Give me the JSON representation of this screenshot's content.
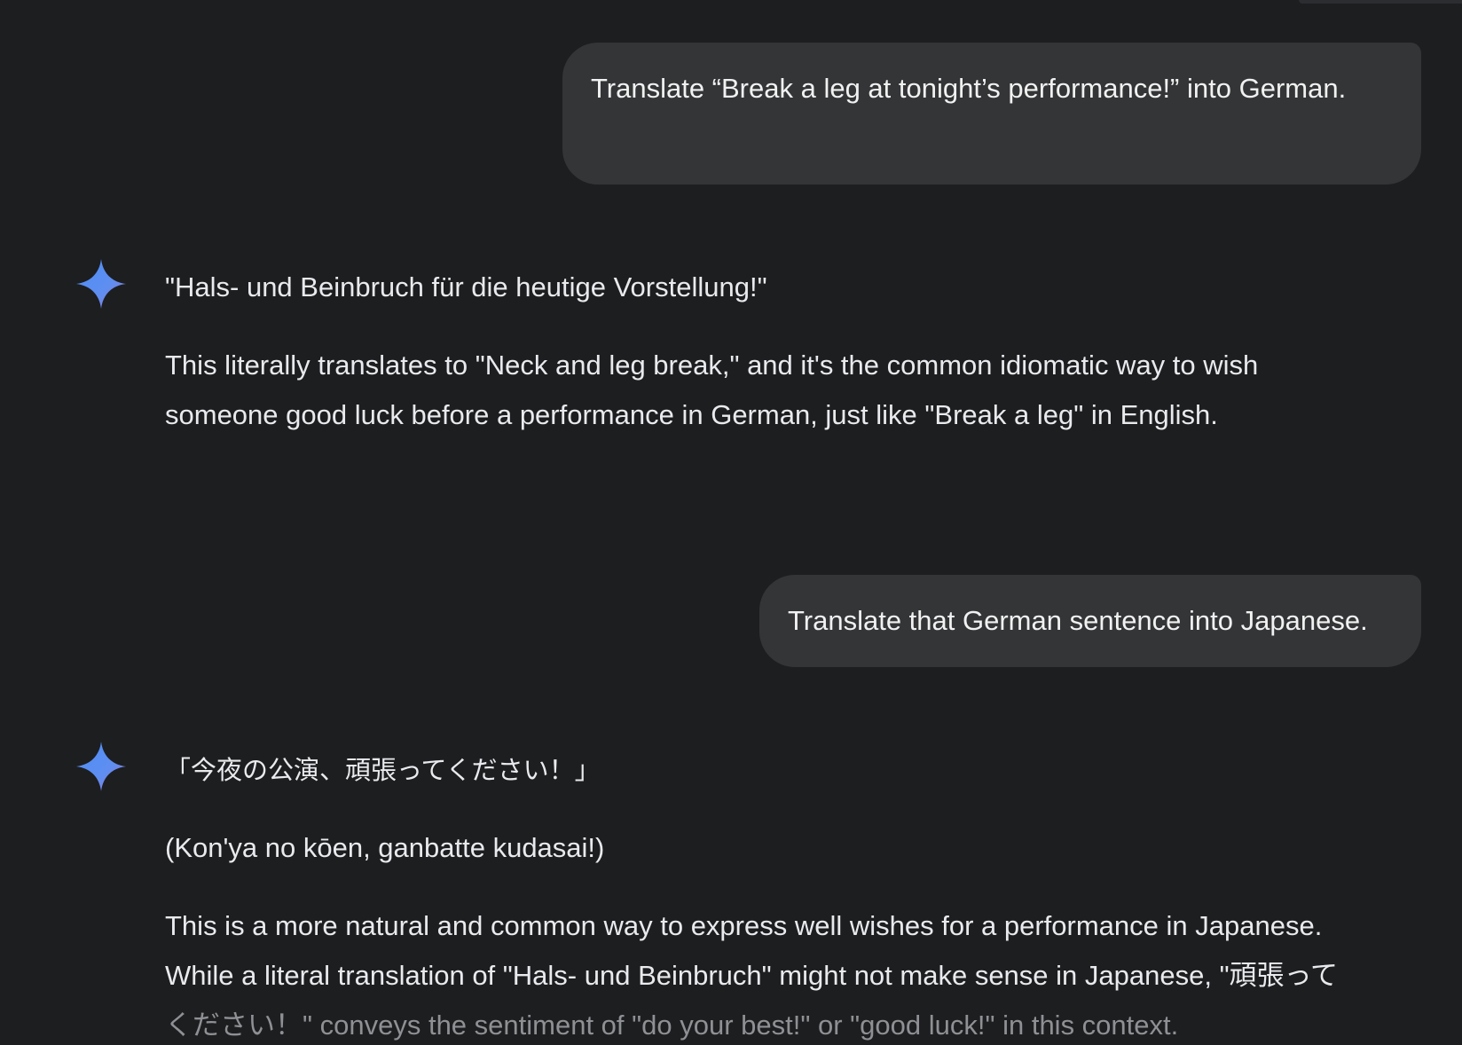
{
  "conversation": {
    "messages": [
      {
        "role": "user",
        "text": "Translate “Break a leg at tonight’s performance!” into German."
      },
      {
        "role": "model",
        "quote": "\"Hals- und Beinbruch für die heutige Vorstellung!\"",
        "body": "This literally translates to \"Neck and leg break,\" and it's the common idiomatic way to wish someone good luck before a performance in German, just like \"Break a leg\" in English."
      },
      {
        "role": "user",
        "text": "Translate that German sentence into Japanese."
      },
      {
        "role": "model",
        "quote": "「今夜の公演、頑張ってください！」",
        "romanization": "(Kon'ya no kōen, ganbatte kudasai!)",
        "body_line1": "This is a more natural and common way to express well wishes for a performance in Japanese.",
        "body_line2": "While a literal translation of \"Hals- und Beinbruch\" might not make sense in Japanese, \"頑張って",
        "body_line3_faded": "ください！\" conveys the sentiment of \"do your best!\" or \"good luck!\" in this context."
      }
    ]
  },
  "icons": {
    "model_avatar": "gemini-sparkle-icon"
  },
  "colors": {
    "background": "#1d1e20",
    "user_bubble": "#333537",
    "text": "#e8eaed",
    "sparkle_gradient_start": "#4c8df6",
    "sparkle_gradient_end": "#9b72cb"
  }
}
